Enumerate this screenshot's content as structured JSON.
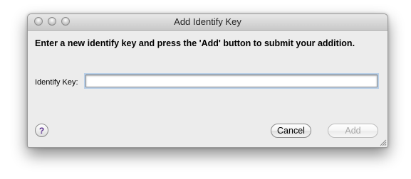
{
  "window": {
    "title": "Add Identify Key"
  },
  "dialog": {
    "instructions": "Enter a new identify key and press the 'Add' button to submit your addition.",
    "field_label": "Identify Key:",
    "field_value": "",
    "field_placeholder": ""
  },
  "buttons": {
    "help_label": "?",
    "cancel_label": "Cancel",
    "add_label": "Add",
    "add_enabled": false
  },
  "icons": {
    "window_controls": [
      "close-button-icon",
      "minimize-button-icon",
      "zoom-button-icon"
    ],
    "help": "question-mark-icon",
    "resize": "resize-grip-icon"
  },
  "colors": {
    "focus_ring": "#b8cfe8",
    "help_glyph": "#5a2e8f",
    "disabled_text": "#a8a8a8"
  }
}
